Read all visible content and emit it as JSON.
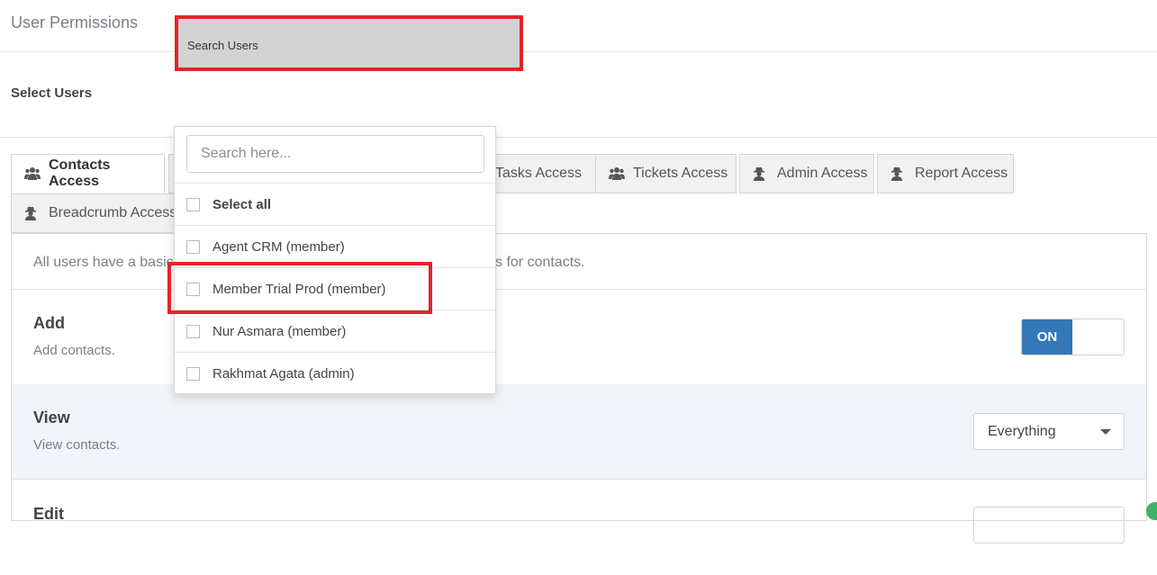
{
  "page": {
    "title": "User Permissions"
  },
  "select_users": {
    "label": "Select Users",
    "picker_text": "Search Users"
  },
  "tabs": [
    {
      "label": "Contacts Access",
      "icon": "users-icon",
      "active": true
    },
    {
      "label": "Tasks Access",
      "icon": "tasks-icon",
      "active": false
    },
    {
      "label": "Tickets Access",
      "icon": "users-icon",
      "active": false
    },
    {
      "label": "Admin Access",
      "icon": "user-secret-icon",
      "active": false
    },
    {
      "label": "Report Access",
      "icon": "user-secret-icon",
      "active": false
    },
    {
      "label": "Breadcrumb Access",
      "icon": "user-secret-icon",
      "active": false
    }
  ],
  "info": {
    "prefix": "All users have a basic",
    "suffix": "s for contacts."
  },
  "permissions": [
    {
      "title": "Add",
      "description": "Add contacts.",
      "control": "toggle",
      "toggle_label": "ON"
    },
    {
      "title": "View",
      "description": "View contacts.",
      "control": "select",
      "selected": "Everything"
    },
    {
      "title": "Edit"
    }
  ],
  "dropdown": {
    "search_placeholder": "Search here...",
    "search_value": "",
    "items": [
      {
        "label": "Select all",
        "checked": false,
        "bold": true
      },
      {
        "label": "Agent CRM (member)",
        "checked": false
      },
      {
        "label": "Member Trial Prod (member)",
        "checked": false,
        "highlighted": true
      },
      {
        "label": "Nur Asmara (member)",
        "checked": false
      },
      {
        "label": "Rakhmat Agata (admin)",
        "checked": false
      }
    ]
  },
  "colors": {
    "accent": "#3378b8",
    "highlight": "#e3242b",
    "picker_bg": "#d3d3d3"
  }
}
